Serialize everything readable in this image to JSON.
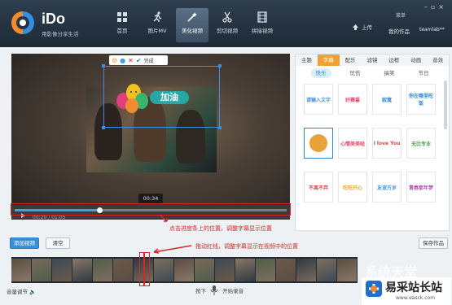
{
  "app": {
    "name": "iDo",
    "slogan": "用影像分享生活"
  },
  "nav": [
    {
      "label": "首页",
      "icon": "grid-icon"
    },
    {
      "label": "图片MV",
      "icon": "runner-icon"
    },
    {
      "label": "美化视频",
      "icon": "magic-wand-icon",
      "active": true
    },
    {
      "label": "剪切视频",
      "icon": "scissors-icon"
    },
    {
      "label": "拼接视频",
      "icon": "film-icon"
    }
  ],
  "header": {
    "upload_label": "上传",
    "mywork_label": "我的作品",
    "account_label": "teamlab**",
    "login_label": "菜单"
  },
  "preview": {
    "popup_text": "完成",
    "subtitle_text": "加油",
    "time_tip": "00:34",
    "timecode": "00:20 / 01:05",
    "progress": 0.31
  },
  "annotations": {
    "progress_note": "点击进度条上的位置，调整字幕显示位置",
    "marker_note": "拖动红线，调整字幕显示在视频中的位置"
  },
  "panel": {
    "categories": [
      "主题",
      "字幕",
      "配乐",
      "滤镜",
      "边框",
      "动画",
      "音效"
    ],
    "active_category": "字幕",
    "subcategories": [
      "快乐",
      "忧伤",
      "搞笑",
      "节日"
    ],
    "active_subcategory": "快乐",
    "stickers": [
      {
        "text": "请输入文字",
        "color": "#4a90d9"
      },
      {
        "text": "好赛最",
        "color": "#e04a6a"
      },
      {
        "text": "寂寞",
        "color": "#2b86d6"
      },
      {
        "text": "你在哪里吃饭",
        "color": "#2b86d6"
      },
      {
        "text": "",
        "color": "#e8a23a"
      },
      {
        "text": "心情美美哒",
        "color": "#e04a6a"
      },
      {
        "text": "I love You",
        "color": "#d94a4a"
      },
      {
        "text": "无比专业",
        "color": "#4aa04a"
      },
      {
        "text": "不离不弃",
        "color": "#d94a4a"
      },
      {
        "text": "吃吃开心",
        "color": "#e8a23a"
      },
      {
        "text": "友谊万岁",
        "color": "#4a90d9"
      },
      {
        "text": "青春那年梦",
        "color": "#b04ab0"
      },
      {
        "text": "",
        "color": "#888888"
      }
    ]
  },
  "bottom": {
    "add_video_label": "添加视频",
    "clear_label": "清空",
    "save_label": "保存作品",
    "volume_label": "音量调节",
    "press_label": "按下",
    "record_label": "开始录音"
  },
  "watermark": {
    "text1": "易采站长站",
    "text2": "www.easck.com",
    "text3": "系统天堂"
  }
}
